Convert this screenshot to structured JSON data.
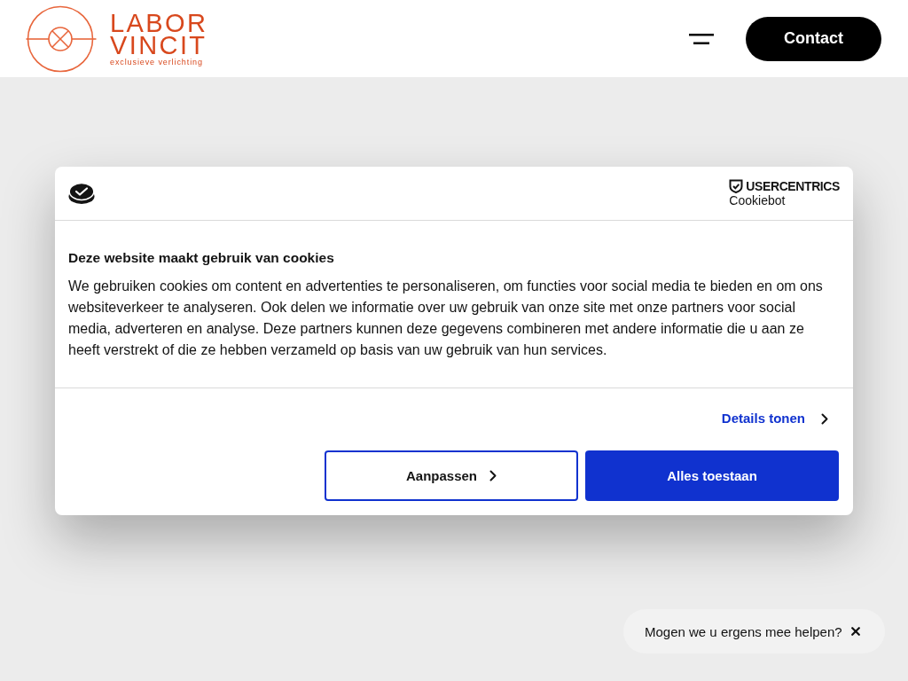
{
  "header": {
    "logo": {
      "line_1": "LABOR",
      "line_2": "VINCIT",
      "tagline": "exclusieve verlichting"
    },
    "contact_button": "Contact"
  },
  "cookie_dialog": {
    "brand": {
      "name": "USERCENTRICS",
      "product": "Cookiebot"
    },
    "title": "Deze website maakt gebruik van cookies",
    "body": "We gebruiken cookies om content en advertenties te personaliseren, om functies voor social media te bieden en om ons websiteverkeer te analyseren. Ook delen we informatie over uw gebruik van onze site met onze partners voor social media, adverteren en analyse. Deze partners kunnen deze gegevens combineren met andere informatie die u aan ze heeft verstrekt of die ze hebben verzameld op basis van uw gebruik van hun services.",
    "details_link": "Details tonen",
    "buttons": [
      {
        "label": "Aanpassen",
        "kind": "outline"
      },
      {
        "label": "Alles toestaan",
        "kind": "filled"
      }
    ]
  },
  "chat_prompt": {
    "text": "Mogen we u ergens mee helpen?"
  }
}
